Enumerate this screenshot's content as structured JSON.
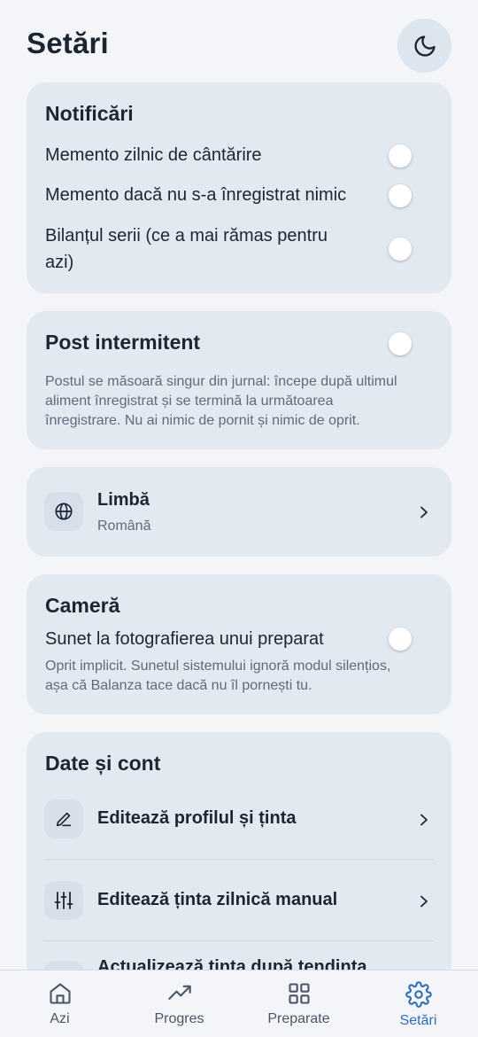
{
  "header": {
    "title": "Setări",
    "theme_icon": "moon-icon"
  },
  "notifications": {
    "title": "Notificări",
    "items": [
      {
        "label": "Memento zilnic de cântărire",
        "on": false
      },
      {
        "label": "Memento dacă nu s-a înregistrat nimic",
        "on": false
      },
      {
        "label": "Bilanțul serii (ce a mai rămas pentru",
        "label2": "azi)",
        "on": false
      }
    ]
  },
  "fasting": {
    "title": "Post intermitent",
    "on": false,
    "line1": "Postul se măsoară singur din jurnal: începe după ultimul",
    "line2": "aliment înregistrat și se termină la următoarea",
    "line3": "înregistrare. Nu ai nimic de pornit și nimic de oprit."
  },
  "language": {
    "title": "Limbă",
    "value": "Română",
    "icon": "globe-icon"
  },
  "camera": {
    "title": "Cameră",
    "toggle_label": "Sunet la fotografierea unui preparat",
    "on": false,
    "line1": "Oprit implicit. Sunetul sistemului ignoră modul silențios,",
    "line2": "așa că Balanza tace dacă nu îl pornești tu."
  },
  "account": {
    "title": "Date și cont",
    "items": [
      {
        "label": "Editează profilul și ținta",
        "icon": "pencil-icon"
      },
      {
        "label": "Editează ținta zilnică manual",
        "icon": "sliders-icon"
      },
      {
        "label": "Actualizează ținta după tendința",
        "icon": "trend-icon"
      }
    ]
  },
  "nav": {
    "active": "Setări",
    "items": [
      {
        "label": "Azi",
        "icon": "home-icon"
      },
      {
        "label": "Progres",
        "icon": "trending-up-icon"
      },
      {
        "label": "Preparate",
        "icon": "grid-icon"
      },
      {
        "label": "Setări",
        "icon": "gear-icon"
      }
    ]
  },
  "colors": {
    "background": "#f3f5f9",
    "card": "#e2e9f1",
    "text": "#1c2633",
    "muted": "#5f6b7b",
    "accent": "#2f6db5"
  }
}
